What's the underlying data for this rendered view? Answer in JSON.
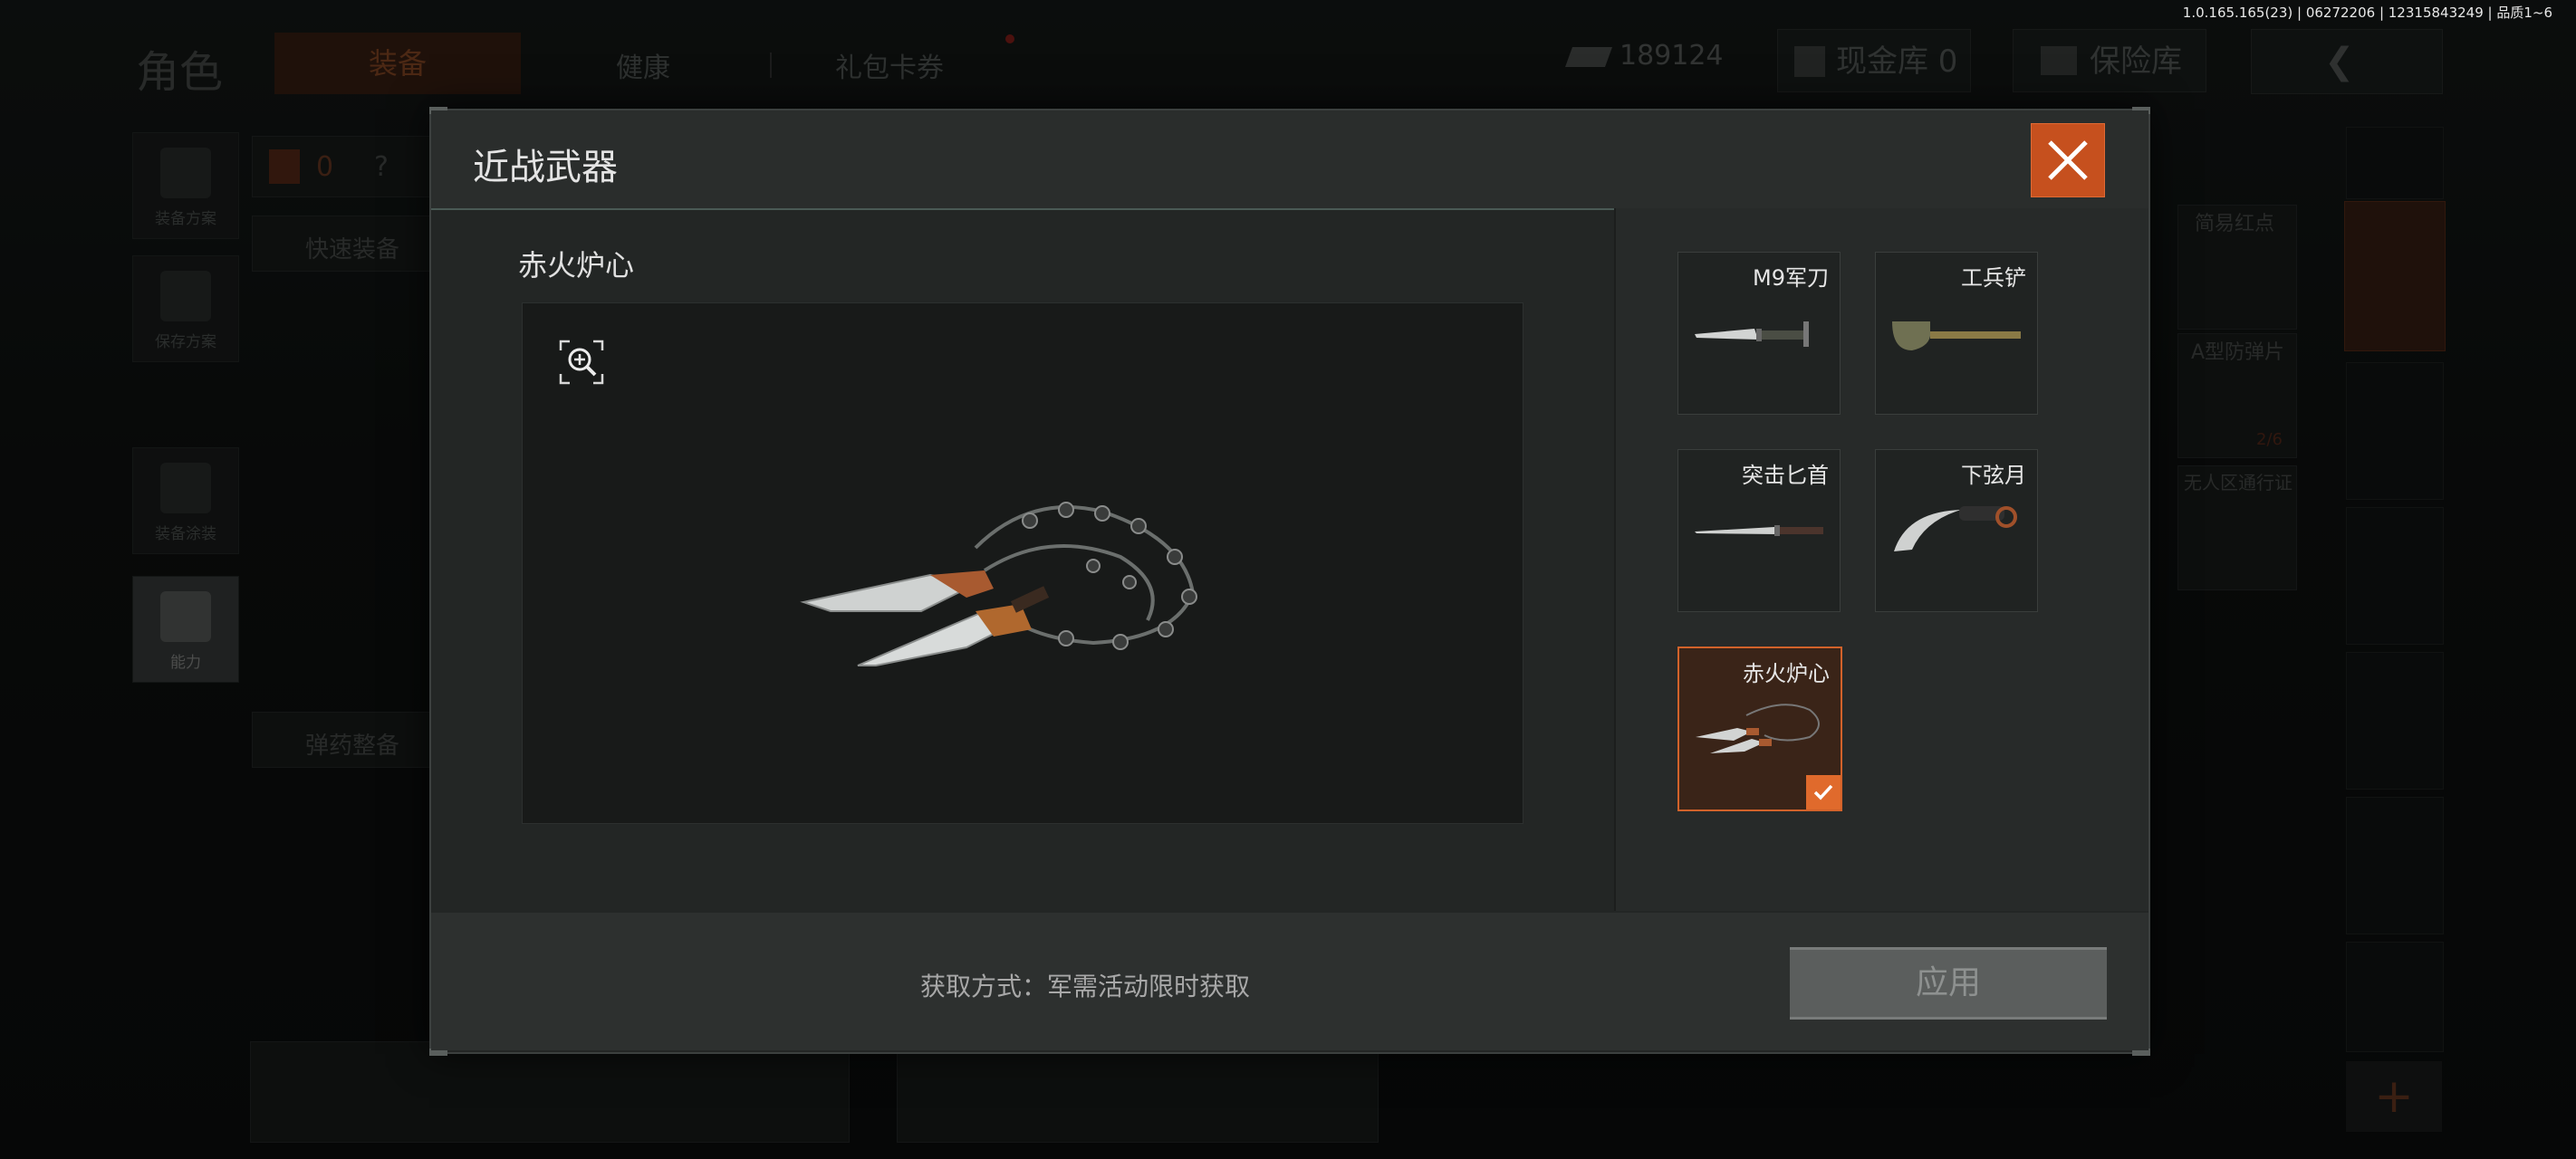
{
  "version": "1.0.165.165(23) | 06272206 | 12315843249 | 品质1~6",
  "header": {
    "title": "角色",
    "tabs": [
      {
        "label": "装备",
        "active": true
      },
      {
        "label": "健康"
      },
      {
        "label": "礼包卡券"
      }
    ],
    "currency": "189124",
    "cash_vault": "现金库 0",
    "insurance": "保险库"
  },
  "left_sidebar": [
    {
      "label": "装备方案",
      "icon": "vest-icon"
    },
    {
      "label": "保存方案",
      "icon": "download-icon"
    },
    {
      "label": "装备涂装",
      "icon": "helmet-icon"
    },
    {
      "label": "能力",
      "icon": "lightning-hex-icon",
      "active": true
    }
  ],
  "background_panel": {
    "armor_count": "0",
    "help": "?",
    "quick_equip": "快速装备",
    "ammo": "弹药整备",
    "cards": [
      {
        "label": "简易红点"
      },
      {
        "label": "A型防弹片",
        "count": "2/6"
      },
      {
        "label": "无人区通行证"
      }
    ]
  },
  "modal": {
    "title": "近战武器",
    "selected_name": "赤火炉心",
    "items": [
      {
        "name": "M9军刀",
        "icon": "bayonet-icon"
      },
      {
        "name": "工兵铲",
        "icon": "shovel-icon"
      },
      {
        "name": "突击匕首",
        "icon": "dagger-icon"
      },
      {
        "name": "下弦月",
        "icon": "karambit-icon"
      },
      {
        "name": "赤火炉心",
        "icon": "chain-blade-icon",
        "selected": true
      }
    ],
    "obtain_method": "获取方式：军需活动限时获取",
    "apply_label": "应用"
  },
  "colors": {
    "accent": "#e06a2c",
    "close_bg": "#c6501e",
    "modal_bg": "#232625"
  }
}
